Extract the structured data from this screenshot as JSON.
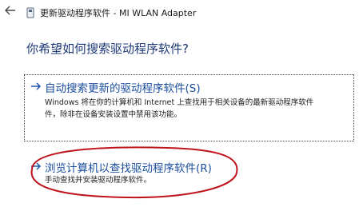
{
  "window": {
    "title": "更新驱动程序软件 - MI WLAN Adapter"
  },
  "icons": {
    "back": "back-arrow-icon",
    "device": "device-icon"
  },
  "main": {
    "question": "你希望如何搜索驱动程序软件?",
    "options": [
      {
        "title": "自动搜索更新的驱动程序软件(S)",
        "description_line1": "Windows 将在你的计算机和 Internet 上查找用于相关设备的最新驱动程序软件",
        "description_line2": "件，除非在设备安装设置中禁用该功能。"
      },
      {
        "title": "浏览计算机以查找驱动程序软件(R)",
        "description_line1": "手动查找并安装驱动程序软件。"
      }
    ]
  },
  "colors": {
    "accent": "#1c4fa0",
    "highlight": "#c0141c"
  }
}
